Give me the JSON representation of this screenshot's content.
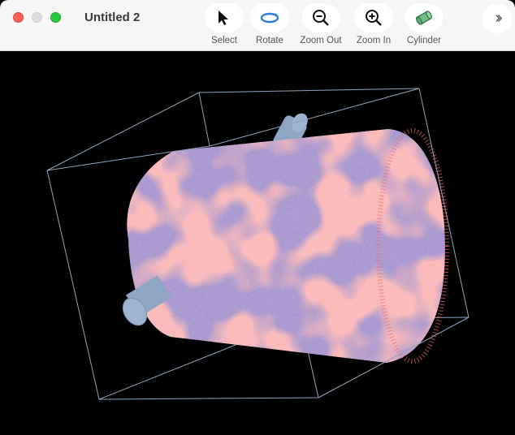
{
  "window": {
    "title": "Untitled 2"
  },
  "toolbar": {
    "tools": [
      {
        "label": "Select",
        "icon": "arrow-cursor-icon"
      },
      {
        "label": "Rotate",
        "icon": "rotate-icon"
      },
      {
        "label": "Zoom Out",
        "icon": "zoom-out-icon"
      },
      {
        "label": "Zoom In",
        "icon": "zoom-in-icon"
      },
      {
        "label": "Cylinder",
        "icon": "cylinder-icon"
      }
    ],
    "more_icon": "chevrons-right-icon"
  },
  "scene": {
    "background": "#000000",
    "point_colors": [
      "#f26b6b",
      "#9a86c6"
    ],
    "box_color": "#8fa3b8",
    "axle_color": "#8ea6c4"
  }
}
